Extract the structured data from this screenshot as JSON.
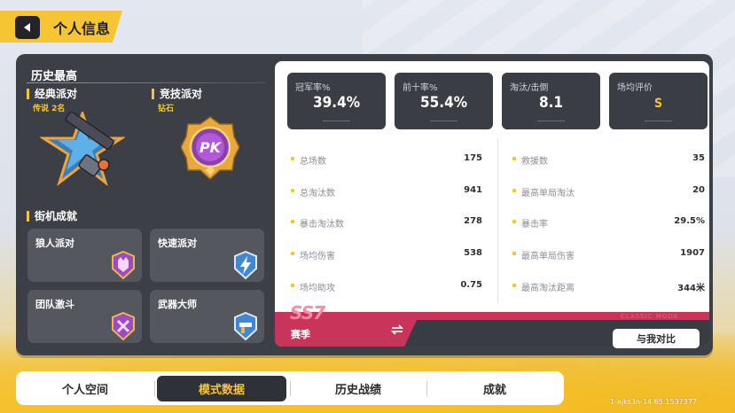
{
  "header": {
    "title": "个人信息"
  },
  "history": {
    "title": "历史最高",
    "modes": [
      {
        "name": "经典派对",
        "rank": "传说 2名"
      },
      {
        "name": "竞技派对",
        "rank": "钻石"
      }
    ],
    "arcade_title": "街机成就",
    "arcade": [
      {
        "name": "狼人派对"
      },
      {
        "name": "快速派对"
      },
      {
        "name": "团队激斗"
      },
      {
        "name": "武器大师"
      }
    ]
  },
  "stats": {
    "top": [
      {
        "label": "冠军率%",
        "value": "39.4%"
      },
      {
        "label": "前十率%",
        "value": "55.4%"
      },
      {
        "label": "淘汰/击倒",
        "value": "8.1"
      },
      {
        "label": "场均评价",
        "value": "S"
      }
    ],
    "left": [
      {
        "label": "总场数",
        "value": "175"
      },
      {
        "label": "总淘汰数",
        "value": "941"
      },
      {
        "label": "暴击淘汰数",
        "value": "278"
      },
      {
        "label": "场均伤害",
        "value": "538"
      },
      {
        "label": "场均助攻",
        "value": "0.75"
      }
    ],
    "right": [
      {
        "label": "救援数",
        "value": "35"
      },
      {
        "label": "最高单局淘汰",
        "value": "20"
      },
      {
        "label": "暴击率",
        "value": "29.5%"
      },
      {
        "label": "最高单局伤害",
        "value": "1907"
      },
      {
        "label": "最高淘汰距离",
        "value": "344米"
      }
    ]
  },
  "season": {
    "code": "SS7",
    "label": "赛季",
    "watermark": "CLASSIC MODE",
    "compare_label": "与我对比"
  },
  "tabs": [
    {
      "label": "个人空间",
      "active": false
    },
    {
      "label": "模式数据",
      "active": true
    },
    {
      "label": "历史战绩",
      "active": false
    },
    {
      "label": "成就",
      "active": false
    }
  ],
  "version": "1-ajks3n-14.65.1537377",
  "colors": {
    "accent": "#f6c534",
    "panel": "#3d3f47",
    "season": "#c9355a"
  }
}
